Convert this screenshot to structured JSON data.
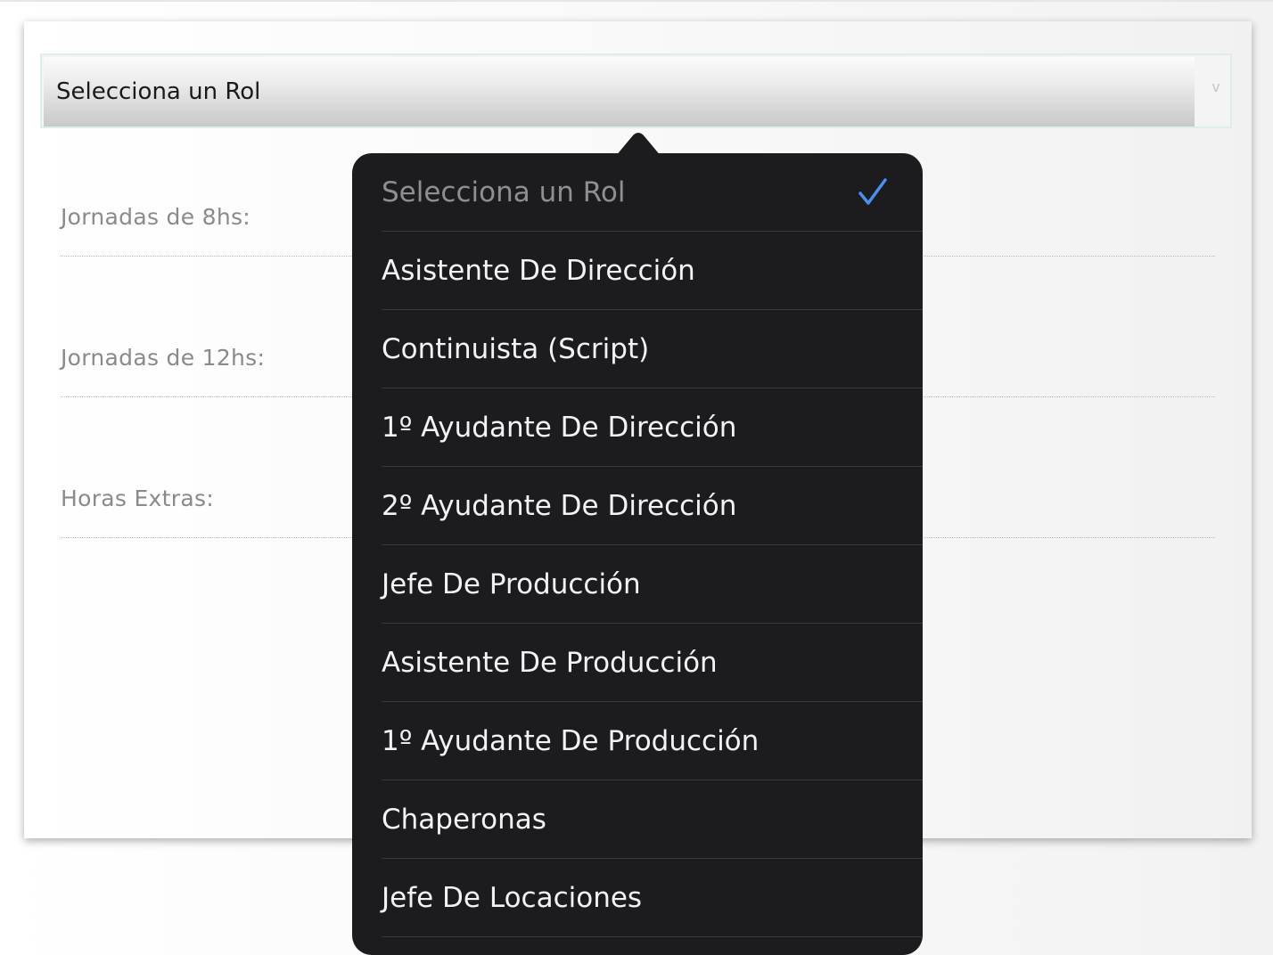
{
  "select": {
    "value": "Selecciona un Rol",
    "arrow_glyph": "v"
  },
  "fields": [
    {
      "label": "Jornadas de 8hs:"
    },
    {
      "label": "Jornadas de 12hs:"
    },
    {
      "label": "Horas Extras:"
    }
  ],
  "dropdown": {
    "options": [
      {
        "label": "Selecciona un Rol",
        "selected": true
      },
      {
        "label": "Asistente De Dirección",
        "selected": false
      },
      {
        "label": "Continuista (Script)",
        "selected": false
      },
      {
        "label": "1º Ayudante De Dirección",
        "selected": false
      },
      {
        "label": "2º Ayudante De Dirección",
        "selected": false
      },
      {
        "label": "Jefe De Producción",
        "selected": false
      },
      {
        "label": "Asistente De Producción",
        "selected": false
      },
      {
        "label": "1º Ayudante De Producción",
        "selected": false
      },
      {
        "label": "Chaperonas",
        "selected": false
      },
      {
        "label": "Jefe De Locaciones",
        "selected": false
      }
    ],
    "check_icon": "checkmark-icon",
    "check_color": "#4a8ff0"
  },
  "colors": {
    "popover_bg": "#1c1c1e",
    "option_text": "#f2f2f7",
    "placeholder_text": "#8e8e93",
    "field_label": "#8a8a8a"
  }
}
